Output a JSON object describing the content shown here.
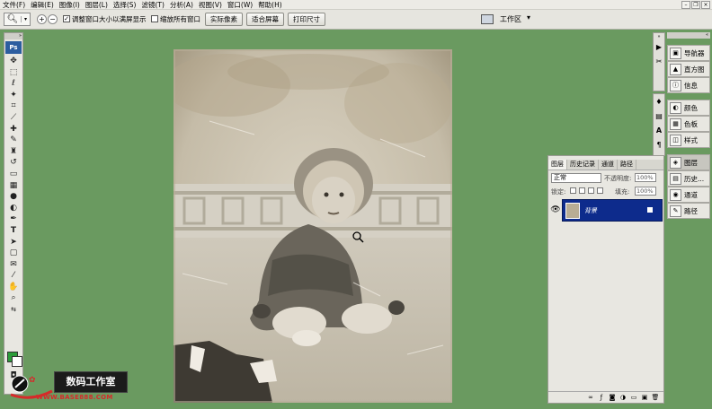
{
  "menu": [
    "文件(F)",
    "编辑(E)",
    "图像(I)",
    "图层(L)",
    "选择(S)",
    "滤镜(T)",
    "分析(A)",
    "视图(V)",
    "窗口(W)",
    "帮助(H)"
  ],
  "options": {
    "resize_windows_label": "调整窗口大小以满屏显示",
    "zoom_all_label": "缩放所有窗口",
    "actual_pixels": "实际像素",
    "fit_screen": "适合屏幕",
    "print_size": "打印尺寸",
    "workspace": "工作区"
  },
  "tools": {
    "ps_logo": "Ps"
  },
  "watermark": {
    "title": "数码工作室",
    "url": "WWW.BASE888.COM"
  },
  "layers_panel": {
    "tabs": [
      "图层",
      "历史记录",
      "通道",
      "路径"
    ],
    "blend_mode": "正常",
    "opacity_label": "不透明度:",
    "opacity_value": "100%",
    "lock_label": "锁定:",
    "fill_label": "填充:",
    "fill_value": "100%",
    "layer_name": "背景"
  },
  "dock": {
    "group1": [
      "导航器",
      "直方图",
      "信息"
    ],
    "group2": [
      "颜色",
      "色板",
      "样式"
    ],
    "group3": [
      "图层",
      "历史...",
      "通道",
      "路径"
    ]
  },
  "colors": {
    "canvas_bg": "#6a9a60",
    "foreground": "#2c9c3a",
    "layer_selected": "#0d2b8c"
  }
}
